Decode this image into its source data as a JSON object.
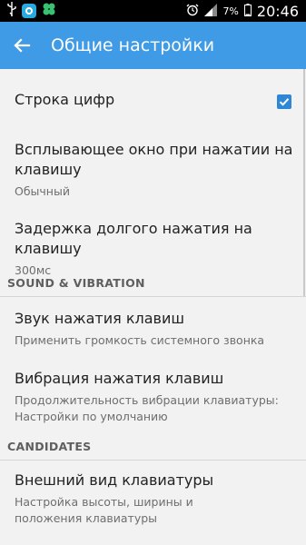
{
  "status_bar": {
    "battery": "7%",
    "time": "20:46"
  },
  "app_bar": {
    "title": "Общие настройки"
  },
  "settings": [
    {
      "title": "Строка цифр",
      "checked": true
    },
    {
      "title": "Всплывающее окно при нажатии на клавишу",
      "summary": "Обычный"
    },
    {
      "title": "Задержка долгого нажатия на клавишу",
      "summary": "300мс"
    }
  ],
  "sections": [
    {
      "header": "SOUND & VIBRATION",
      "items": [
        {
          "title": "Звук нажатия клавиш",
          "summary": "Применить громкость системного звонка"
        },
        {
          "title": "Вибрация нажатия клавиш",
          "summary": "Продолжительность вибрации клавиатуры: Настройки по умолчанию"
        }
      ]
    },
    {
      "header": "CANDIDATES",
      "items": [
        {
          "title": "Внешний вид клавиатуры",
          "summary": "Настройка высоты, ширины и положения клавиатуры"
        }
      ]
    }
  ],
  "colors": {
    "app_bar": "#3f9be6",
    "checkbox": "#2e86d6"
  }
}
